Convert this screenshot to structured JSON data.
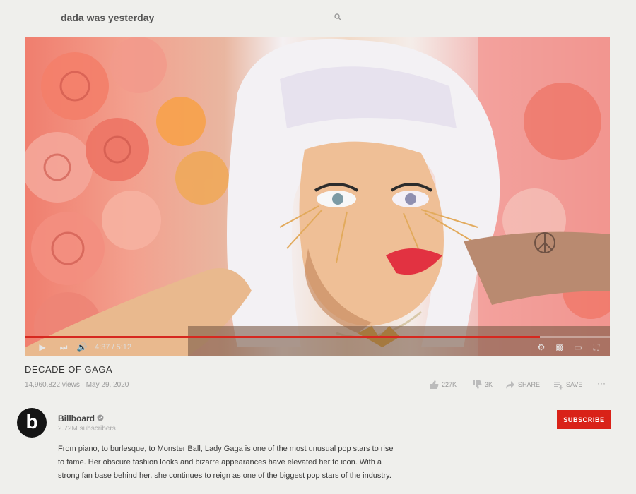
{
  "search": {
    "query": "dada was yesterday",
    "icon": "search-icon"
  },
  "player": {
    "progress_fraction": 0.88,
    "time": "4:37 / 5:12",
    "icons": [
      "play-icon",
      "next-icon",
      "volume-icon",
      "settings-icon",
      "miniplayer-icon",
      "theater-icon",
      "fullscreen-icon"
    ],
    "progress_color": "#d6281f"
  },
  "video": {
    "title": "DECADE OF GAGA",
    "views": "14,960,822 views · May 29, 2020",
    "actions": {
      "like": "227K",
      "dislike": "3K",
      "share": "SHARE",
      "save": "SAVE",
      "more": "···"
    }
  },
  "channel": {
    "name": "Billboard",
    "avatar_letter": "b",
    "subscribers": "2.72M subscribers",
    "subscribe_label": "SUBSCRIBE",
    "subscribe_color": "#d92218"
  },
  "description": {
    "lines": [
      "From piano, to burlesque, to Monster Ball, Lady Gaga is one of the most unusual pop stars to rise",
      "to fame. Her obscure fashion looks and bizarre appearances have elevated her to icon. With a",
      "strong fan base behind her, she continues to reign as one of the biggest pop stars of the industry."
    ]
  }
}
